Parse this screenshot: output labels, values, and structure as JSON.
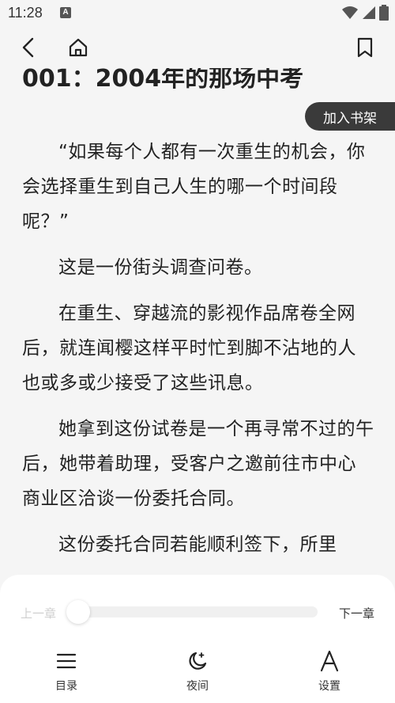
{
  "status": {
    "time": "11:28",
    "notif_icon_letter": "A"
  },
  "nav": {
    "back_icon": "chevron-left-icon",
    "home_icon": "home-icon",
    "bookmark_icon": "bookmark-icon"
  },
  "chapter": {
    "title": "001：2004年的那场中考",
    "add_to_shelf": "加入书架",
    "paragraphs": [
      "“如果每个人都有一次重生的机会，你会选择重生到自己人生的哪一个时间段呢？”",
      "这是一份街头调查问卷。",
      "在重生、穿越流的影视作品席卷全网后，就连闻樱这样平时忙到脚不沾地的人也或多或少接受了这些讯息。",
      "她拿到这份试卷是一个再寻常不过的午后，她带着助理，受客户之邀前往市中心商业区洽谈一份委托合同。",
      "这份委托合同若能顺利签下，所里"
    ]
  },
  "reader_controls": {
    "prev_chapter": "上一章",
    "next_chapter": "下一章",
    "progress": 0,
    "menu": [
      {
        "label": "目录",
        "icon": "list-icon"
      },
      {
        "label": "夜间",
        "icon": "moon-icon"
      },
      {
        "label": "设置",
        "icon": "font-a-icon"
      }
    ]
  }
}
